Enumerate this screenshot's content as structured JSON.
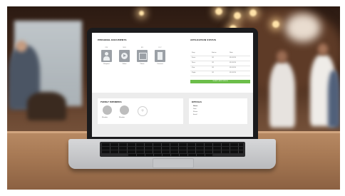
{
  "screen": {
    "documents_heading": "PERSONAL DOCUMENTS",
    "documents": [
      {
        "tag": "PDF",
        "label": "Passport"
      },
      {
        "tag": "MP4",
        "label": "Video"
      },
      {
        "tag": "JPG",
        "label": "Photo"
      },
      {
        "tag": "DOC",
        "label": "Contract"
      }
    ],
    "table_heading": "APPLICATION STATUS",
    "table_header": [
      "Step",
      "Status",
      "Date"
    ],
    "table_rows": [
      [
        "Form",
        "OK",
        "01/02/20"
      ],
      [
        "Docs",
        "OK",
        "01/02/20"
      ],
      [
        "Visa",
        "OK",
        "01/02/20"
      ],
      [
        "Flight",
        "OK",
        "01/02/20"
      ]
    ],
    "button_label": "SUBMIT APPLICATION",
    "members_heading": "FAMILY MEMBERS",
    "members": [
      "Member",
      "Member"
    ],
    "add_symbol": "+",
    "details_heading": "DETAILS",
    "details": [
      "Name",
      "Date",
      "Phone",
      "Email"
    ]
  }
}
